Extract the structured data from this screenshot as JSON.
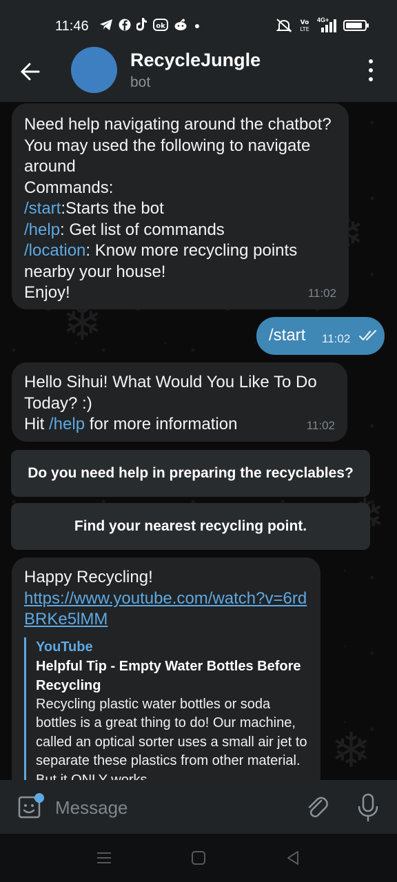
{
  "status_bar": {
    "time": "11:46",
    "left_icons": [
      "telegram-icon",
      "facebook-icon",
      "tiktok-icon",
      "app-icon",
      "reddit-icon",
      "dot-icon"
    ],
    "right_icons": [
      "mute-icon",
      "volte-icon",
      "signal-4g-icon",
      "battery-icon"
    ],
    "network_label": "4G+"
  },
  "header": {
    "title": "RecycleJungle",
    "subtitle": "bot"
  },
  "messages": {
    "m1": {
      "line1": "Need help navigating around the chatbot? You may used the following to navigate around",
      "line2": "Commands:",
      "cmd_start": "/start",
      "cmd_start_desc": ":Starts the bot",
      "cmd_help": "/help",
      "cmd_help_desc": ": Get list of commands",
      "cmd_location": "/location",
      "cmd_location_desc": ": Know more recycling points nearby your house!",
      "line_end": "Enjoy!",
      "time": "11:02"
    },
    "m2": {
      "text": "/start",
      "time": "11:02"
    },
    "m3": {
      "line1": "Hello Sihui! What Would You Like To Do Today? :)",
      "hit": "Hit ",
      "cmd_help": "/help",
      "rest": " for more information",
      "time": "11:02"
    },
    "m4": {
      "line1": "Happy Recycling!",
      "link": "https://www.youtube.com/watch?v=6rdBRKe5lMM",
      "preview_site": "YouTube",
      "preview_title": "Helpful Tip - Empty Water Bottles Before Recycling",
      "preview_desc": "Recycling plastic water bottles or soda bottles is a great thing to do! Our machine, called an optical sorter uses a small air jet to separate these plastics from other material. But it ONLY works"
    }
  },
  "keyboard": {
    "button1": "Do you need help in preparing the recyclables?",
    "button2": "Find your nearest recycling point."
  },
  "input": {
    "placeholder": "Message",
    "value": ""
  },
  "colors": {
    "accent": "#5ea9e3",
    "outgoing_bubble": "#3f87b5",
    "incoming_bubble": "#212325",
    "header_bg": "#202426",
    "avatar": "#3e7fc1"
  }
}
